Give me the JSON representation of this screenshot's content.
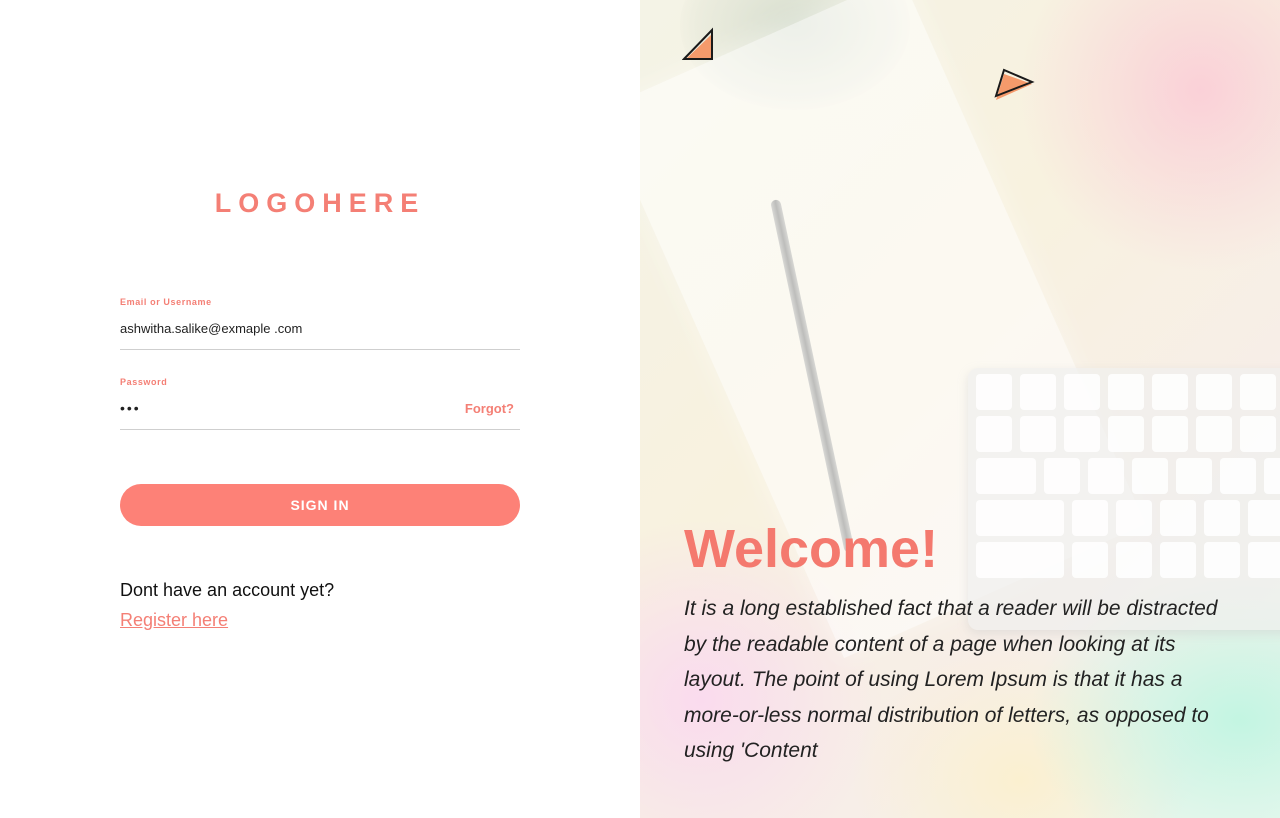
{
  "brand": {
    "logo_text": "LOGOHERE",
    "accent_color": "#f47f75",
    "button_color": "#fd8177"
  },
  "login_form": {
    "email_label": "Email or Username",
    "email_value": "ashwitha.salike@exmaple .com",
    "password_label": "Password",
    "password_mask": "•••",
    "forgot_link": "Forgot?",
    "submit_label": "SIGN IN"
  },
  "register": {
    "prompt": "Dont have an account yet?",
    "link": "Register here"
  },
  "hero": {
    "heading": "Welcome!",
    "body": "It is a long established fact that a reader will be distracted by the readable content of a page when looking at its layout. The point of using Lorem Ipsum is that it has a more-or-less normal distribution of letters, as opposed to using 'Content",
    "icons": [
      "triangle-icon",
      "triangle-icon"
    ]
  }
}
